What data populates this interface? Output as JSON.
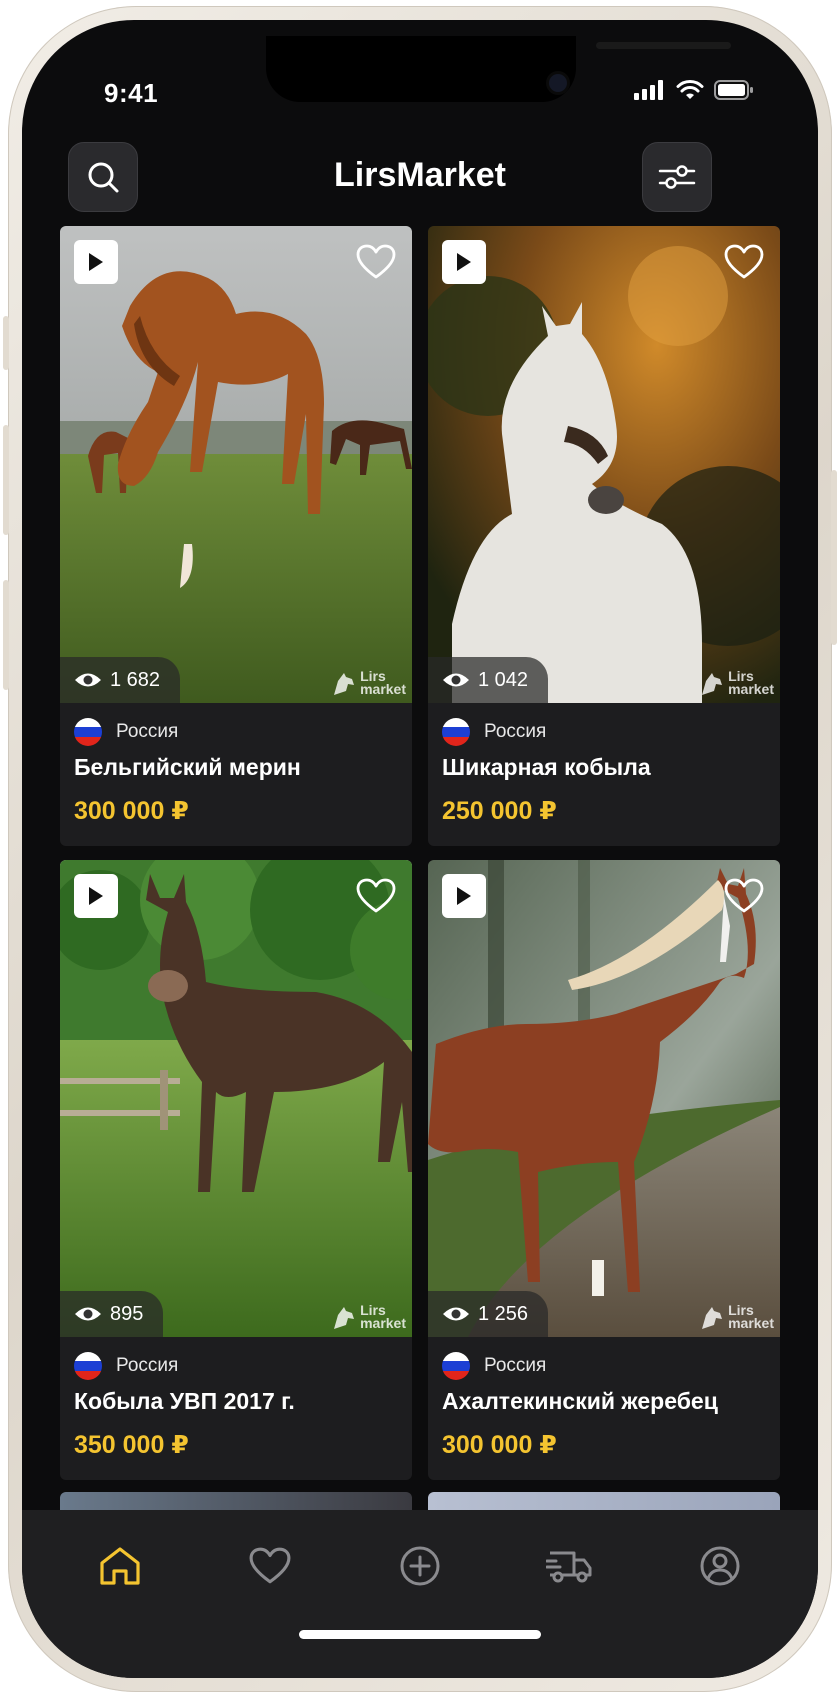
{
  "status_bar": {
    "time": "9:41"
  },
  "header": {
    "title": "LirsMarket"
  },
  "watermark": {
    "line1": "Lirs",
    "line2": "market"
  },
  "listings": [
    {
      "views": "1 682",
      "country": "Россия",
      "title": "Бельгийский мерин",
      "price": "300 000 ₽"
    },
    {
      "views": "1 042",
      "country": "Россия",
      "title": "Шикарная кобыла",
      "price": "250 000 ₽"
    },
    {
      "views": "895",
      "country": "Россия",
      "title": "Кобыла УВП 2017 г.",
      "price": "350 000 ₽"
    },
    {
      "views": "1 256",
      "country": "Россия",
      "title": "Ахалтекинский жеребец",
      "price": "300 000 ₽"
    }
  ],
  "tabbar": {
    "items": [
      {
        "icon": "home-icon",
        "active": true
      },
      {
        "icon": "heart-icon",
        "active": false
      },
      {
        "icon": "plus-circle-icon",
        "active": false
      },
      {
        "icon": "truck-icon",
        "active": false
      },
      {
        "icon": "user-icon",
        "active": false
      }
    ]
  },
  "colors": {
    "accent": "#f4c430",
    "background": "#0c0c0d",
    "card": "#1d1d1f",
    "tab_inactive": "#8a8a8e"
  }
}
